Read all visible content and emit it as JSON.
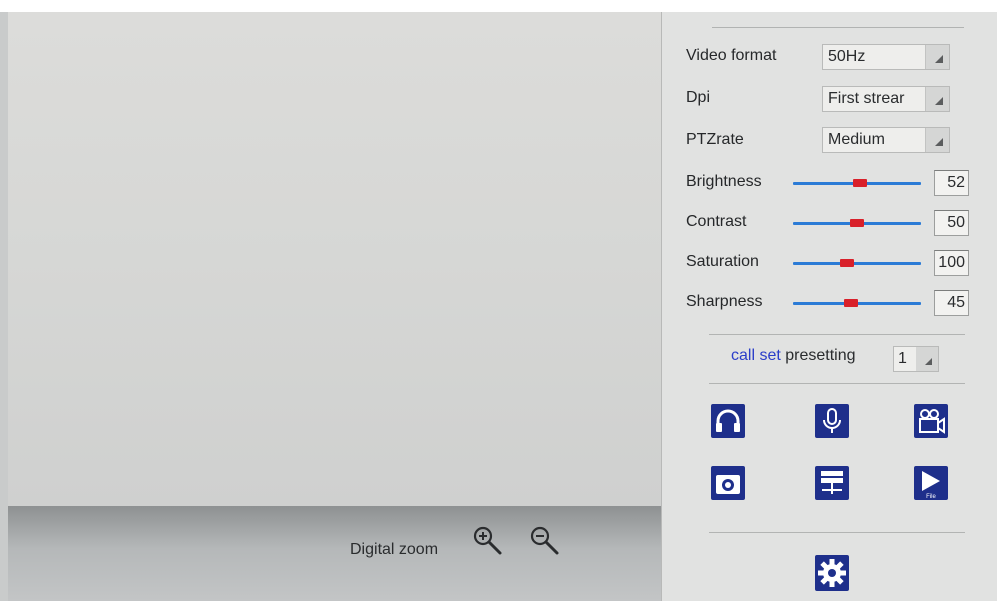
{
  "zoom": {
    "label": "Digital zoom"
  },
  "settings": {
    "video_format": {
      "label": "Video format",
      "value": "50Hz"
    },
    "dpi": {
      "label": "Dpi",
      "value": "First strear"
    },
    "ptz_rate": {
      "label": "PTZrate",
      "value": "Medium"
    }
  },
  "sliders": [
    {
      "label": "Brightness",
      "value": "52",
      "level": 0.52
    },
    {
      "label": "Contrast",
      "value": "50",
      "level": 0.5
    },
    {
      "label": "Saturation",
      "value": "100",
      "level": 0.42
    },
    {
      "label": "Sharpness",
      "value": "45",
      "level": 0.45
    }
  ],
  "preset": {
    "call_label": "call set",
    "text": "presetting",
    "value": "1"
  },
  "icons": [
    "headphones-icon",
    "microphone-icon",
    "video-camera-icon",
    "camera-icon",
    "network-icon",
    "file-play-icon",
    "gear-icon"
  ],
  "icon_text": {
    "file": "File"
  },
  "colors": {
    "accent_blue": "#1e2f8b",
    "slider_track": "#2b7bd6",
    "slider_thumb": "#d8202a",
    "link_blue": "#2b3ec9"
  }
}
